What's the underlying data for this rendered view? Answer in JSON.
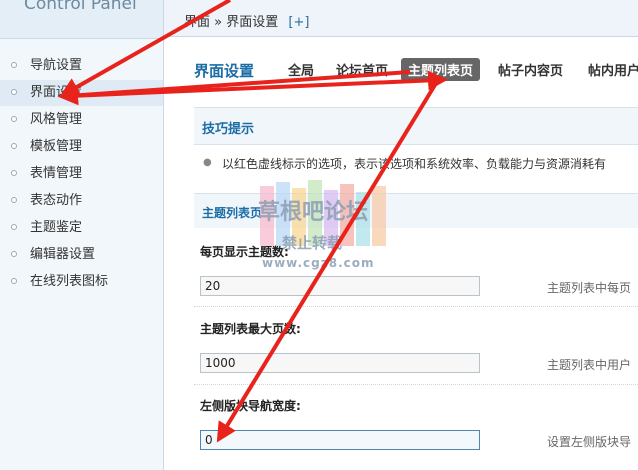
{
  "sidebar": {
    "logo": "Control Panel",
    "items": [
      {
        "label": "导航设置"
      },
      {
        "label": "界面设置"
      },
      {
        "label": "风格管理"
      },
      {
        "label": "模板管理"
      },
      {
        "label": "表情管理"
      },
      {
        "label": "表态动作"
      },
      {
        "label": "主题鉴定"
      },
      {
        "label": "编辑器设置"
      },
      {
        "label": "在线列表图标"
      }
    ]
  },
  "header": {
    "crumb_parent": "界面",
    "crumb_sep": "»",
    "crumb_current": "界面设置",
    "add_label": "[+]"
  },
  "main": {
    "title": "界面设置",
    "tabs": [
      {
        "label": "全局"
      },
      {
        "label": "论坛首页"
      },
      {
        "label": "主题列表页"
      },
      {
        "label": "帖子内容页"
      },
      {
        "label": "帖内用户"
      }
    ],
    "tips_title": "技巧提示",
    "tip_text": "以红色虚线标示的选项，表示该选项和系统效率、负载能力与资源消耗有",
    "section_title": "主题列表页",
    "fields": [
      {
        "label": "每页显示主题数:",
        "value": "20",
        "hint": "主题列表中每页"
      },
      {
        "label": "主题列表最大页数:",
        "value": "1000",
        "hint": "主题列表中用户"
      },
      {
        "label": "左侧版块导航宽度:",
        "value": "0",
        "hint": "设置左侧版块导"
      }
    ]
  },
  "watermark": {
    "line1": "草根吧论坛",
    "line2": "禁止转载",
    "line3": "www.cgz8.com"
  },
  "colors": {
    "accent": "#1c6da6",
    "arrow": "#e8231c",
    "active_tab_bg": "#666666"
  }
}
